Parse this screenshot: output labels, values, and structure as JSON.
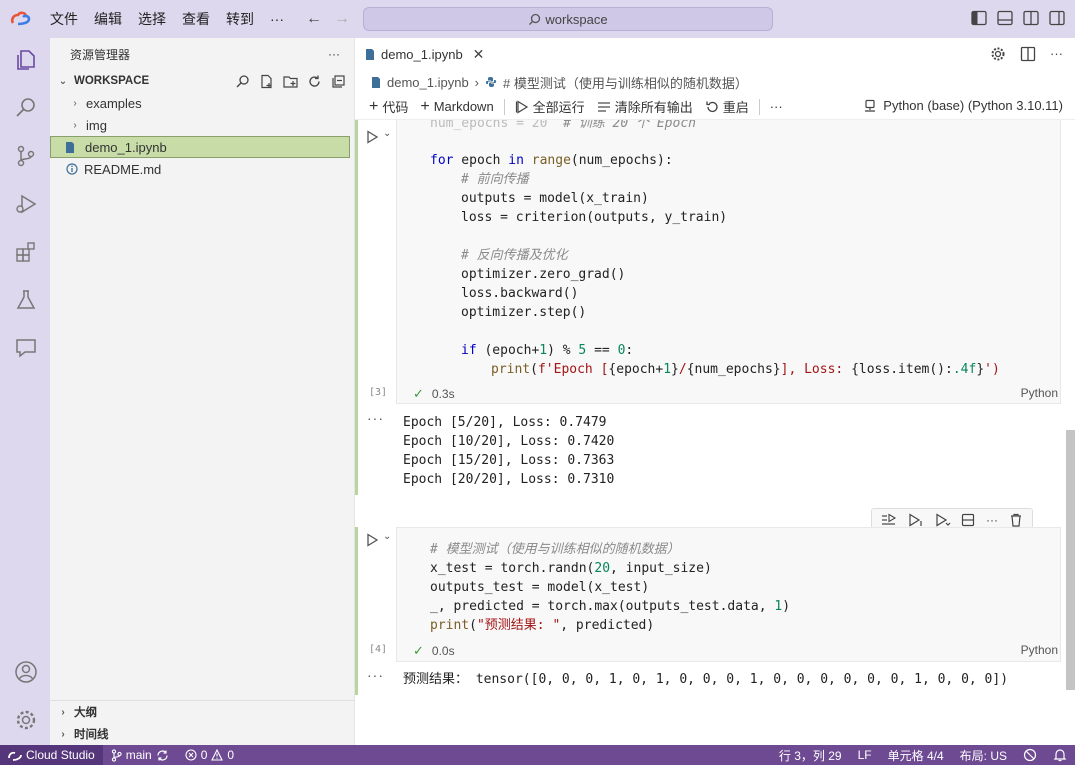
{
  "titlebar": {
    "menus": [
      "文件",
      "编辑",
      "选择",
      "查看",
      "转到",
      "···"
    ],
    "search": "workspace"
  },
  "sidebar": {
    "title": "资源管理器",
    "more": "···",
    "workspace_label": "WORKSPACE",
    "tree": [
      {
        "label": "examples",
        "type": "folder"
      },
      {
        "label": "img",
        "type": "folder"
      },
      {
        "label": "demo_1.ipynb",
        "type": "notebook",
        "selected": true
      },
      {
        "label": "README.md",
        "type": "info"
      }
    ],
    "bottom": [
      "大纲",
      "时间线"
    ]
  },
  "editor": {
    "tab_label": "demo_1.ipynb",
    "breadcrumb": {
      "file": "demo_1.ipynb",
      "section": "# 模型测试（使用与训练相似的随机数据）"
    },
    "toolbar": {
      "code": "代码",
      "markdown": "Markdown",
      "run_all": "全部运行",
      "clear_outputs": "清除所有输出",
      "restart": "重启",
      "more": "···",
      "kernel": "Python (base) (Python 3.10.11)"
    },
    "cell1": {
      "exec_count": "[3]",
      "status": "0.3s",
      "lang": "Python"
    },
    "output1": [
      "Epoch [5/20], Loss: 0.7479",
      "Epoch [10/20], Loss: 0.7420",
      "Epoch [15/20], Loss: 0.7363",
      "Epoch [20/20], Loss: 0.7310"
    ],
    "cell2": {
      "exec_count": "[4]",
      "status": "0.0s",
      "lang": "Python"
    },
    "output2": "预测结果： tensor([0, 0, 0, 1, 0, 1, 0, 0, 0, 1, 0, 0, 0, 0, 0, 0, 1, 0, 0, 0])",
    "ellipsis": "···"
  },
  "statusbar": {
    "remote": "Cloud Studio",
    "branch": "main",
    "errors": "0",
    "warnings": "0",
    "position": "行 3，列 29",
    "eol": "LF",
    "cell": "单元格 4/4",
    "layout": "布局: US"
  }
}
